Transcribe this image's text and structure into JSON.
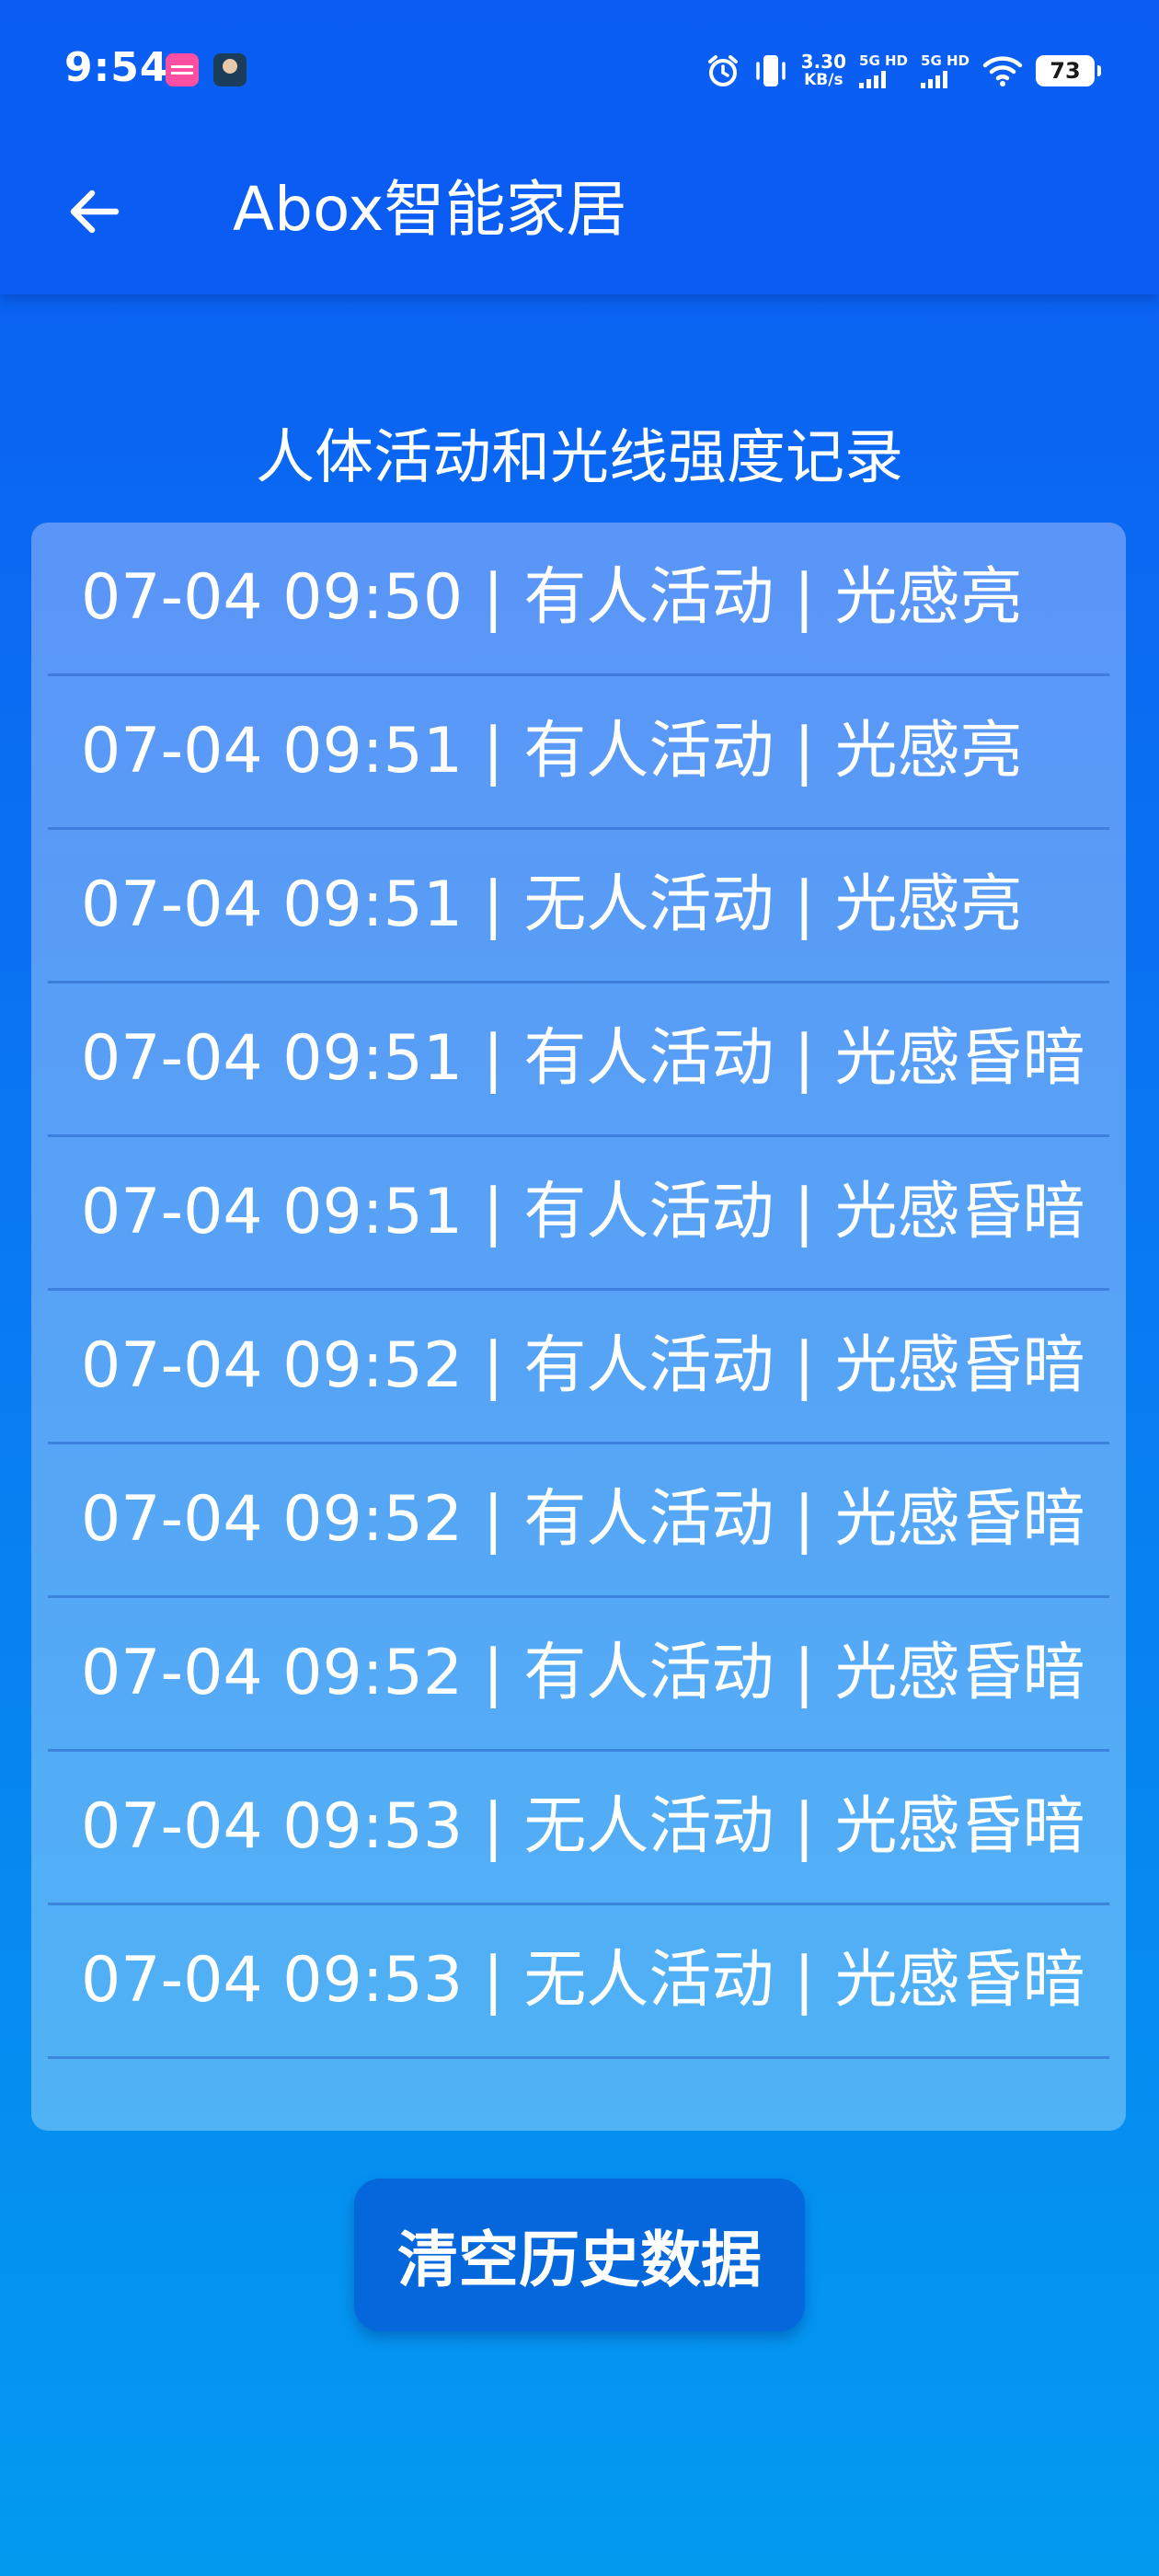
{
  "status_bar": {
    "time": "9:54",
    "net_speed_value": "3.30",
    "net_speed_unit": "KB/s",
    "sim1_label": "5G HD",
    "sim2_label": "5G HD",
    "battery": "73",
    "icons": [
      "alarm-icon",
      "vibrate-icon",
      "wifi-icon"
    ]
  },
  "header": {
    "title": "Abox智能家居",
    "back_icon": "arrow-left-icon"
  },
  "section": {
    "title": "人体活动和光线强度记录"
  },
  "records": [
    "07-04 09:50 | 有人活动 | 光感亮",
    "07-04 09:51 | 有人活动 | 光感亮",
    "07-04 09:51 | 无人活动 | 光感亮",
    "07-04 09:51 | 有人活动 | 光感昏暗",
    "07-04 09:51 | 有人活动 | 光感昏暗",
    "07-04 09:52 | 有人活动 | 光感昏暗",
    "07-04 09:52 | 有人活动 | 光感昏暗",
    "07-04 09:52 | 有人活动 | 光感昏暗",
    "07-04 09:53 | 无人活动 | 光感昏暗",
    "07-04 09:53 | 无人活动 | 光感昏暗"
  ],
  "actions": {
    "clear_label": "清空历史数据"
  },
  "colors": {
    "primary": "#0a5cf2",
    "button": "#0467db",
    "card": "#5a95f7"
  }
}
